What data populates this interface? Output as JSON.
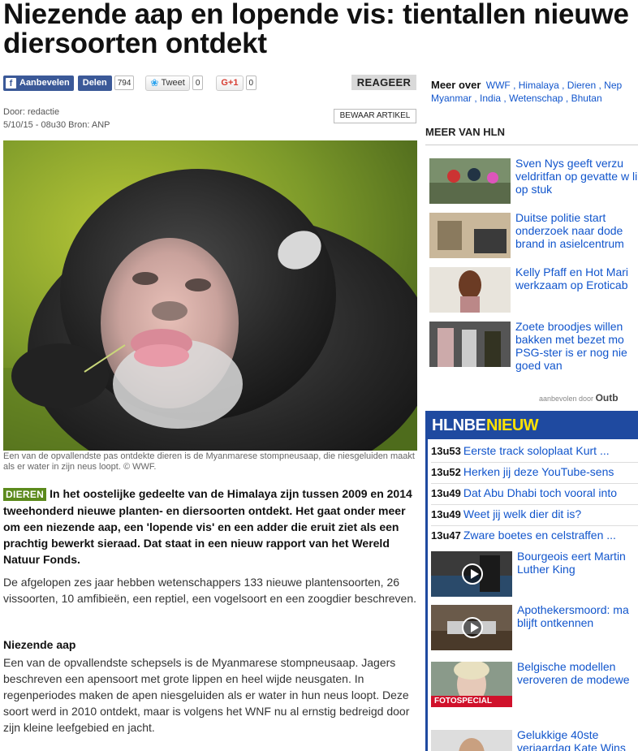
{
  "article": {
    "title": "Niezende aap en lopende vis: tientallen nieuwe diersoorten ontdekt",
    "social": {
      "fb_recommend": "Aanbevelen",
      "fb_share": "Delen",
      "fb_count": "794",
      "tweet": "Tweet",
      "tweet_count": "0",
      "gplus": "G+1",
      "gplus_count": "0"
    },
    "reageer": "REAGEER",
    "author": "Door: redactie",
    "date_source": "5/10/15 - 08u30  Bron: ANP",
    "save_label": "BEWAAR ARTIKEL",
    "caption": "Een van de opvallendste pas ontdekte dieren is de Myanmarese stompneusaap, die niesgeluiden maakt als er water in zijn neus loopt. © WWF.",
    "category": "DIEREN",
    "lead": "In het oostelijke gedeelte van de Himalaya zijn tussen 2009 en 2014 tweehonderd nieuwe planten- en diersoorten ontdekt. Het gaat onder meer om een niezende aap, een 'lopende vis' en een adder die eruit ziet als een prachtig bewerkt sieraad. Dat staat in een nieuw rapport van het Wereld Natuur Fonds.",
    "paragraph1": "De afgelopen zes jaar hebben wetenschappers 133 nieuwe plantensoorten, 26 vissoorten, 10 amfibieën, een reptiel, een vogelsoort en een zoogdier beschreven.",
    "subhead": "Niezende aap",
    "paragraph2": "Een van de opvallendste schepsels is de Myanmarese stompneusaap. Jagers beschreven een apensoort met grote lippen en heel wijde neusgaten. In regenperiodes maken de apen niesgeluiden als er water in hun neus loopt. Deze soort werd in 2010 ontdekt, maar is volgens het WNF nu al ernstig bedreigd door zijn kleine leefgebied en jacht."
  },
  "sidebar": {
    "meer_over_label": "Meer over",
    "tags": [
      "WWF",
      "Himalaya",
      "Dieren",
      "Nep",
      "Myanmar",
      "India",
      "Wetenschap",
      "Bhutan"
    ],
    "meer_van_hln": "MEER VAN HLN",
    "more_items": [
      {
        "text": "Sven Nys geeft verzu veldritfan op gevatte w lik op stuk"
      },
      {
        "text": "Duitse politie start onderzoek naar dode brand in asielcentrum"
      },
      {
        "text": "Kelly Pfaff en Hot Mari werkzaam op Eroticab"
      },
      {
        "text": "Zoete broodjes willen bakken met bezet mo PSG-ster is er nog nie goed van"
      }
    ],
    "outbrain_prefix": "aanbevolen door",
    "outbrain_brand": "Outb",
    "nieuw_box": {
      "brand": "HLNBE",
      "label": "NIEUW",
      "news": [
        {
          "time": "13u53",
          "text": "Eerste track soloplaat Kurt ..."
        },
        {
          "time": "13u52",
          "text": "Herken jij deze YouTube-sens"
        },
        {
          "time": "13u49",
          "text": "Dat Abu Dhabi toch vooral into"
        },
        {
          "time": "13u49",
          "text": "Weet jij welk dier dit is?"
        },
        {
          "time": "13u47",
          "text": "Zware boetes en celstraffen ..."
        }
      ],
      "videos": [
        {
          "text": "Bourgeois eert Martin Luther King"
        },
        {
          "text": "Apothekersmoord: ma blijft ontkennen"
        },
        {
          "text": "Belgische modellen veroveren de modewe",
          "badge": "FOTOSPECIAL"
        },
        {
          "text": "Gelukkige 40ste verjaardag Kate Wins"
        }
      ]
    }
  }
}
